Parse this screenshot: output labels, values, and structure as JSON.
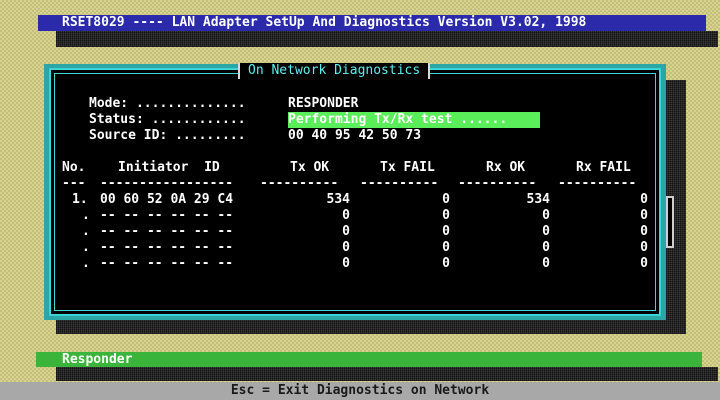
{
  "title": "RSET8029 ---- LAN Adapter SetUp And Diagnostics Version V3.02, 1998",
  "dialog": {
    "title": "On Network Diagnostics",
    "mode_label": "Mode: ..............",
    "mode_value": "RESPONDER",
    "status_label": "Status: ............",
    "status_value": "Performing Tx/Rx test ......",
    "source_label": "Source ID: .........",
    "source_value": "00 40 95 42 50 73"
  },
  "table": {
    "headers": {
      "no": "No.",
      "initiator": "Initiator  ID",
      "tx_ok": "Tx OK",
      "tx_fail": "Tx FAIL",
      "rx_ok": "Rx OK",
      "rx_fail": "Rx FAIL"
    },
    "separators": {
      "no": "---",
      "initiator": "-----------------",
      "tx_ok": "----------",
      "tx_fail": "----------",
      "rx_ok": "----------",
      "rx_fail": "----------"
    },
    "rows": [
      {
        "no": "1.",
        "initiator": "00 60 52 0A 29 C4",
        "tx_ok": "534",
        "tx_fail": "0",
        "rx_ok": "534",
        "rx_fail": "0"
      },
      {
        "no": ".",
        "initiator": "-- -- -- -- -- --",
        "tx_ok": "0",
        "tx_fail": "0",
        "rx_ok": "0",
        "rx_fail": "0"
      },
      {
        "no": ".",
        "initiator": "-- -- -- -- -- --",
        "tx_ok": "0",
        "tx_fail": "0",
        "rx_ok": "0",
        "rx_fail": "0"
      },
      {
        "no": ".",
        "initiator": "-- -- -- -- -- --",
        "tx_ok": "0",
        "tx_fail": "0",
        "rx_ok": "0",
        "rx_fail": "0"
      },
      {
        "no": ".",
        "initiator": "-- -- -- -- -- --",
        "tx_ok": "0",
        "tx_fail": "0",
        "rx_ok": "0",
        "rx_fail": "0"
      }
    ]
  },
  "status_bar": "Responder",
  "help_bar": "Esc = Exit Diagnostics on Network",
  "colors": {
    "title_bar": "#2a2aaa",
    "dialog_frame": "#2aa6a6",
    "status_highlight": "#5aee5a",
    "status_bar": "#3ab43a",
    "desktop": "#d8d48c"
  }
}
